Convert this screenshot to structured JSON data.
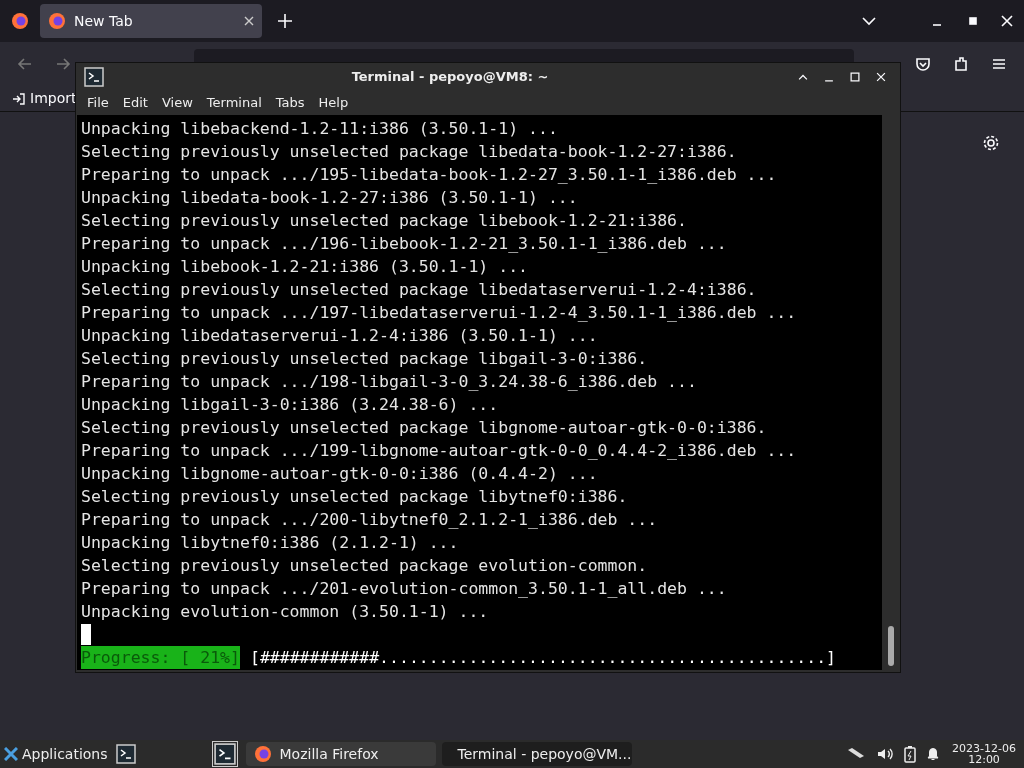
{
  "browser": {
    "tab": {
      "title": "New Tab",
      "selected": true
    },
    "bookmark": "Import"
  },
  "terminal": {
    "title": "Terminal - pepoyo@VM8: ~",
    "menu": [
      "File",
      "Edit",
      "View",
      "Terminal",
      "Tabs",
      "Help"
    ],
    "lines": [
      "Unpacking libebackend-1.2-11:i386 (3.50.1-1) ...",
      "Selecting previously unselected package libedata-book-1.2-27:i386.",
      "Preparing to unpack .../195-libedata-book-1.2-27_3.50.1-1_i386.deb ...",
      "Unpacking libedata-book-1.2-27:i386 (3.50.1-1) ...",
      "Selecting previously unselected package libebook-1.2-21:i386.",
      "Preparing to unpack .../196-libebook-1.2-21_3.50.1-1_i386.deb ...",
      "Unpacking libebook-1.2-21:i386 (3.50.1-1) ...",
      "Selecting previously unselected package libedataserverui-1.2-4:i386.",
      "Preparing to unpack .../197-libedataserverui-1.2-4_3.50.1-1_i386.deb ...",
      "Unpacking libedataserverui-1.2-4:i386 (3.50.1-1) ...",
      "Selecting previously unselected package libgail-3-0:i386.",
      "Preparing to unpack .../198-libgail-3-0_3.24.38-6_i386.deb ...",
      "Unpacking libgail-3-0:i386 (3.24.38-6) ...",
      "Selecting previously unselected package libgnome-autoar-gtk-0-0:i386.",
      "Preparing to unpack .../199-libgnome-autoar-gtk-0-0_0.4.4-2_i386.deb ...",
      "Unpacking libgnome-autoar-gtk-0-0:i386 (0.4.4-2) ...",
      "Selecting previously unselected package libytnef0:i386.",
      "Preparing to unpack .../200-libytnef0_2.1.2-1_i386.deb ...",
      "Unpacking libytnef0:i386 (2.1.2-1) ...",
      "Selecting previously unselected package evolution-common.",
      "Preparing to unpack .../201-evolution-common_3.50.1-1_all.deb ...",
      "Unpacking evolution-common (3.50.1-1) ..."
    ],
    "progress_label": "Progress: [ 21%]",
    "progress_bar": "[############.............................................]"
  },
  "taskbar": {
    "applications": "Applications",
    "tasks": [
      {
        "kind": "firefox",
        "label": "Mozilla Firefox",
        "selected": false
      },
      {
        "kind": "terminal",
        "label": "Terminal - pepoyo@VM...",
        "selected": true
      }
    ],
    "date": "2023-12-06",
    "time": "12:00"
  }
}
